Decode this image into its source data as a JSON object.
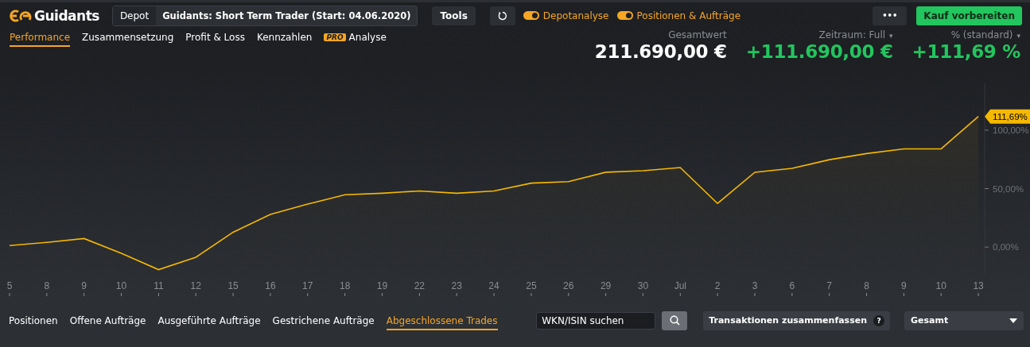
{
  "brand": {
    "name": "Guidants"
  },
  "depot": {
    "label": "Depot",
    "value": "Guidants: Short Term Trader (Start: 04.06.2020)"
  },
  "tools_button": "Tools",
  "toggles": [
    {
      "label": "Depotanalyse",
      "on": true
    },
    {
      "label": "Positionen & Aufträge",
      "on": true
    }
  ],
  "more_button": "•••",
  "buy_button": "Kauf vorbereiten",
  "tabs": [
    {
      "label": "Performance",
      "selected": true
    },
    {
      "label": "Zusammensetzung",
      "selected": false
    },
    {
      "label": "Profit & Loss",
      "selected": false
    },
    {
      "label": "Kennzahlen",
      "selected": false
    },
    {
      "label": "Analyse",
      "badge": "PRO",
      "selected": false
    }
  ],
  "stats": [
    {
      "label": "Gesamtwert",
      "value": "211.690,00 €",
      "positive": false
    },
    {
      "label": "Zeitraum: Full",
      "caret": "▾",
      "value": "+111.690,00 €",
      "positive": true
    },
    {
      "label": "% (standard)",
      "caret": "▾",
      "value": "+111,69 %",
      "positive": true
    }
  ],
  "chart_data": {
    "type": "area",
    "categories": [
      "5",
      "8",
      "9",
      "10",
      "11",
      "12",
      "15",
      "16",
      "17",
      "18",
      "19",
      "22",
      "23",
      "24",
      "25",
      "26",
      "29",
      "30",
      "Jul",
      "2",
      "3",
      "6",
      "7",
      "8",
      "9",
      "10",
      "13"
    ],
    "series": [
      {
        "color": "#f5b800",
        "values": [
          1.3,
          4,
          7.3,
          -5.3,
          -19.3,
          -8.7,
          12.7,
          28,
          36.7,
          44.7,
          46,
          48,
          46,
          48,
          54.7,
          56,
          64,
          65.3,
          68,
          37.3,
          64,
          67.3,
          74.7,
          80,
          84,
          84,
          111.7
        ]
      }
    ],
    "ylim": [
      -23,
      140
    ],
    "yticks": [
      {
        "value": 0,
        "label": "0,00%"
      },
      {
        "value": 50,
        "label": "50,00%"
      },
      {
        "value": 100,
        "label": "100,00%"
      }
    ]
  },
  "last_value_marker": "111,69%",
  "bottom_tabs": [
    {
      "label": "Positionen",
      "selected": false
    },
    {
      "label": "Offene Aufträge",
      "selected": false
    },
    {
      "label": "Ausgeführte Aufträge",
      "selected": false
    },
    {
      "label": "Gestrichene Aufträge",
      "selected": false
    },
    {
      "label": "Abgeschlossene Trades",
      "selected": true
    }
  ],
  "search": {
    "placeholder": "WKN/ISIN suchen"
  },
  "summarize_button": {
    "label": "Transaktionen zusammenfassen",
    "help": "?"
  },
  "filter_select": {
    "value": "Gesamt"
  }
}
